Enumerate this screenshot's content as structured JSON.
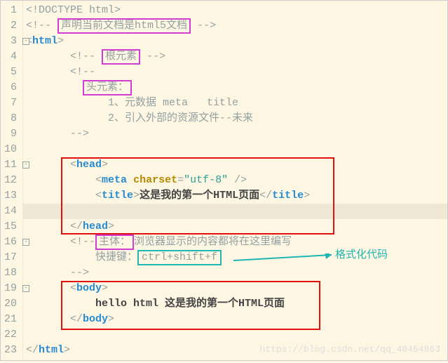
{
  "lines": {
    "l1": {
      "doctype": "<!DOCTYPE html>"
    },
    "l2": {
      "open": "<!--",
      "comment1": "声明当前文档是html5文档",
      "close": "-->"
    },
    "l3": {
      "open": "<",
      "tag": "html",
      "close": ">"
    },
    "l4": {
      "open": "<!--",
      "comment": "根元素",
      "close": "-->"
    },
    "l5": {
      "open": "<!--"
    },
    "l6": {
      "comment": "头元素："
    },
    "l7": {
      "comment": "1、元数据 meta   title"
    },
    "l8": {
      "comment": "2、引入外部的资源文件--未来"
    },
    "l9": {
      "close": "-->"
    },
    "l11": {
      "open": "<",
      "tag": "head",
      "close": ">"
    },
    "l12": {
      "open": "<",
      "tag": "meta",
      "attr": "charset",
      "val": "\"utf-8\"",
      "close": "/>"
    },
    "l13": {
      "open": "<",
      "tag": "title",
      "close": ">",
      "text": "这是我的第一个HTML页面",
      "open2": "</",
      "close2": ">"
    },
    "l15": {
      "open": "</",
      "tag": "head",
      "close": ">"
    },
    "l16": {
      "open": "<!--",
      "hl": "主体：",
      "comment": "浏览器显示的内容都将在这里编写"
    },
    "l17": {
      "comment": "快捷键：",
      "key": "ctrl+shift+f"
    },
    "l18": {
      "close": "-->"
    },
    "l19": {
      "open": "<",
      "tag": "body",
      "close": ">"
    },
    "l20": {
      "text": "hello html 这是我的第一个HTML页面"
    },
    "l21": {
      "open": "</",
      "tag": "body",
      "close": ">"
    },
    "l23": {
      "open": "</",
      "tag": "html",
      "close": ">"
    }
  },
  "annotation": {
    "format": "格式化代码"
  },
  "watermark": "https://blog.csdn.net/qq_40454863"
}
